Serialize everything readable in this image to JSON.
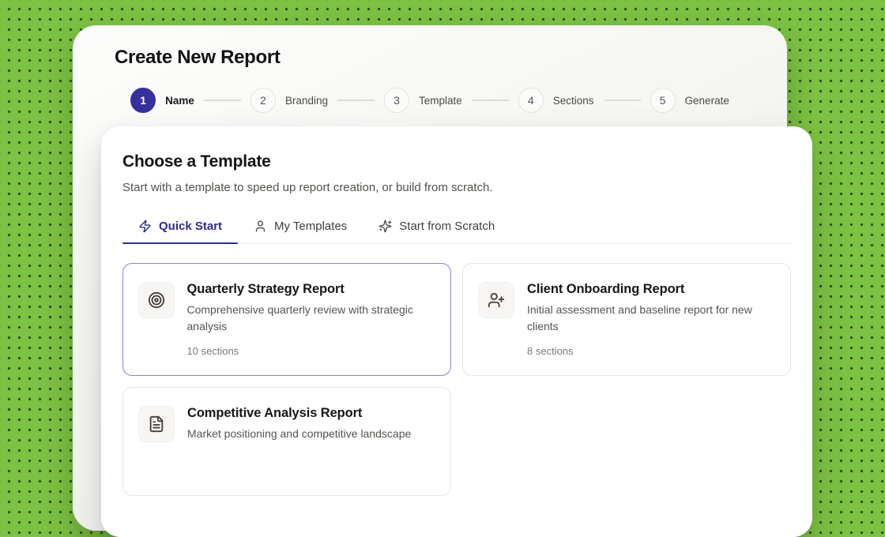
{
  "page": {
    "title": "Create New Report"
  },
  "stepper": {
    "steps": [
      {
        "number": "1",
        "label": "Name",
        "state": "active"
      },
      {
        "number": "2",
        "label": "Branding",
        "state": "upcoming"
      },
      {
        "number": "3",
        "label": "Template",
        "state": "upcoming"
      },
      {
        "number": "4",
        "label": "Sections",
        "state": "upcoming"
      },
      {
        "number": "5",
        "label": "Generate",
        "state": "upcoming"
      }
    ]
  },
  "panel": {
    "title": "Choose a Template",
    "subtitle": "Start with a template to speed up report creation, or build from scratch.",
    "tabs": [
      {
        "label": "Quick Start",
        "icon": "zap-icon",
        "active": true
      },
      {
        "label": "My Templates",
        "icon": "user-icon",
        "active": false
      },
      {
        "label": "Start from Scratch",
        "icon": "sparkles-icon",
        "active": false
      }
    ],
    "templates": [
      {
        "title": "Quarterly Strategy Report",
        "description": "Comprehensive quarterly review with strategic analysis",
        "meta": "10 sections",
        "icon": "target-icon",
        "selected": true
      },
      {
        "title": "Client Onboarding Report",
        "description": "Initial assessment and baseline report for new clients",
        "meta": "8 sections",
        "icon": "user-plus-icon",
        "selected": false
      },
      {
        "title": "Competitive Analysis Report",
        "description": "Market positioning and competitive landscape",
        "meta": "",
        "icon": "file-text-icon",
        "selected": false
      }
    ]
  },
  "colors": {
    "background_green": "#7cc243",
    "accent_indigo": "#372f9e",
    "selected_card_border": "#8a80d6"
  }
}
